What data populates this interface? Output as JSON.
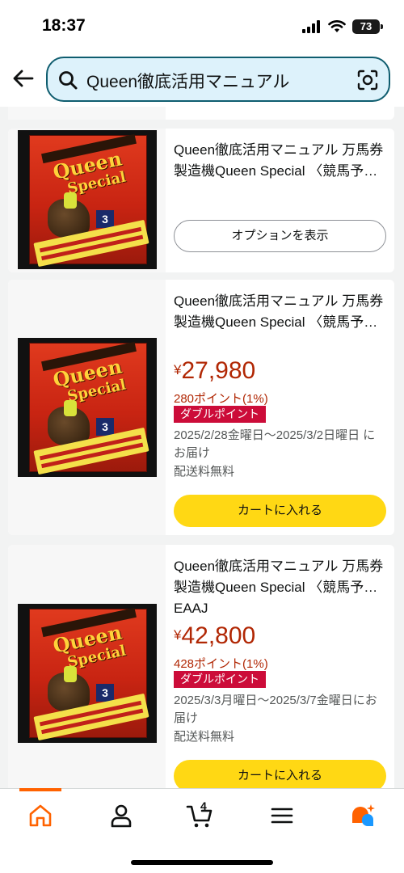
{
  "status": {
    "time": "18:37",
    "battery": "73"
  },
  "search": {
    "query": "Queen徹底活用マニュアル"
  },
  "products": [
    {
      "title": "Queen徹底活用マニュアル 万馬券製造機Queen Special 〈競馬予…",
      "options_label": "オプションを表示"
    },
    {
      "title": "Queen徹底活用マニュアル 万馬券製造機Queen Special 〈競馬予…",
      "price_symbol": "¥",
      "price": "27,980",
      "points": "280ポイント(1%)",
      "badge": "ダブルポイント",
      "delivery": "2025/2/28金曜日～2025/3/2日曜日 にお届け",
      "shipping": "配送料無料",
      "cart_label": "カートに入れる"
    },
    {
      "title": "Queen徹底活用マニュアル 万馬券製造機Queen Special 〈競馬予… EAAJ",
      "price_symbol": "¥",
      "price": "42,800",
      "points": "428ポイント(1%)",
      "badge": "ダブルポイント",
      "delivery": "2025/3/3月曜日～2025/3/7金曜日にお届け",
      "shipping": "配送料無料",
      "cart_label": "カートに入れる"
    }
  ],
  "nav": {
    "cart_count": "4",
    "items": [
      "home-icon",
      "account-icon",
      "cart-icon",
      "menu-icon",
      "rufus-icon"
    ]
  },
  "colors": {
    "accent": "#ff6200",
    "price": "#b12704",
    "badge": "#cc0c39",
    "cart_button": "#ffd814",
    "search_bg": "#ddf2fb"
  }
}
